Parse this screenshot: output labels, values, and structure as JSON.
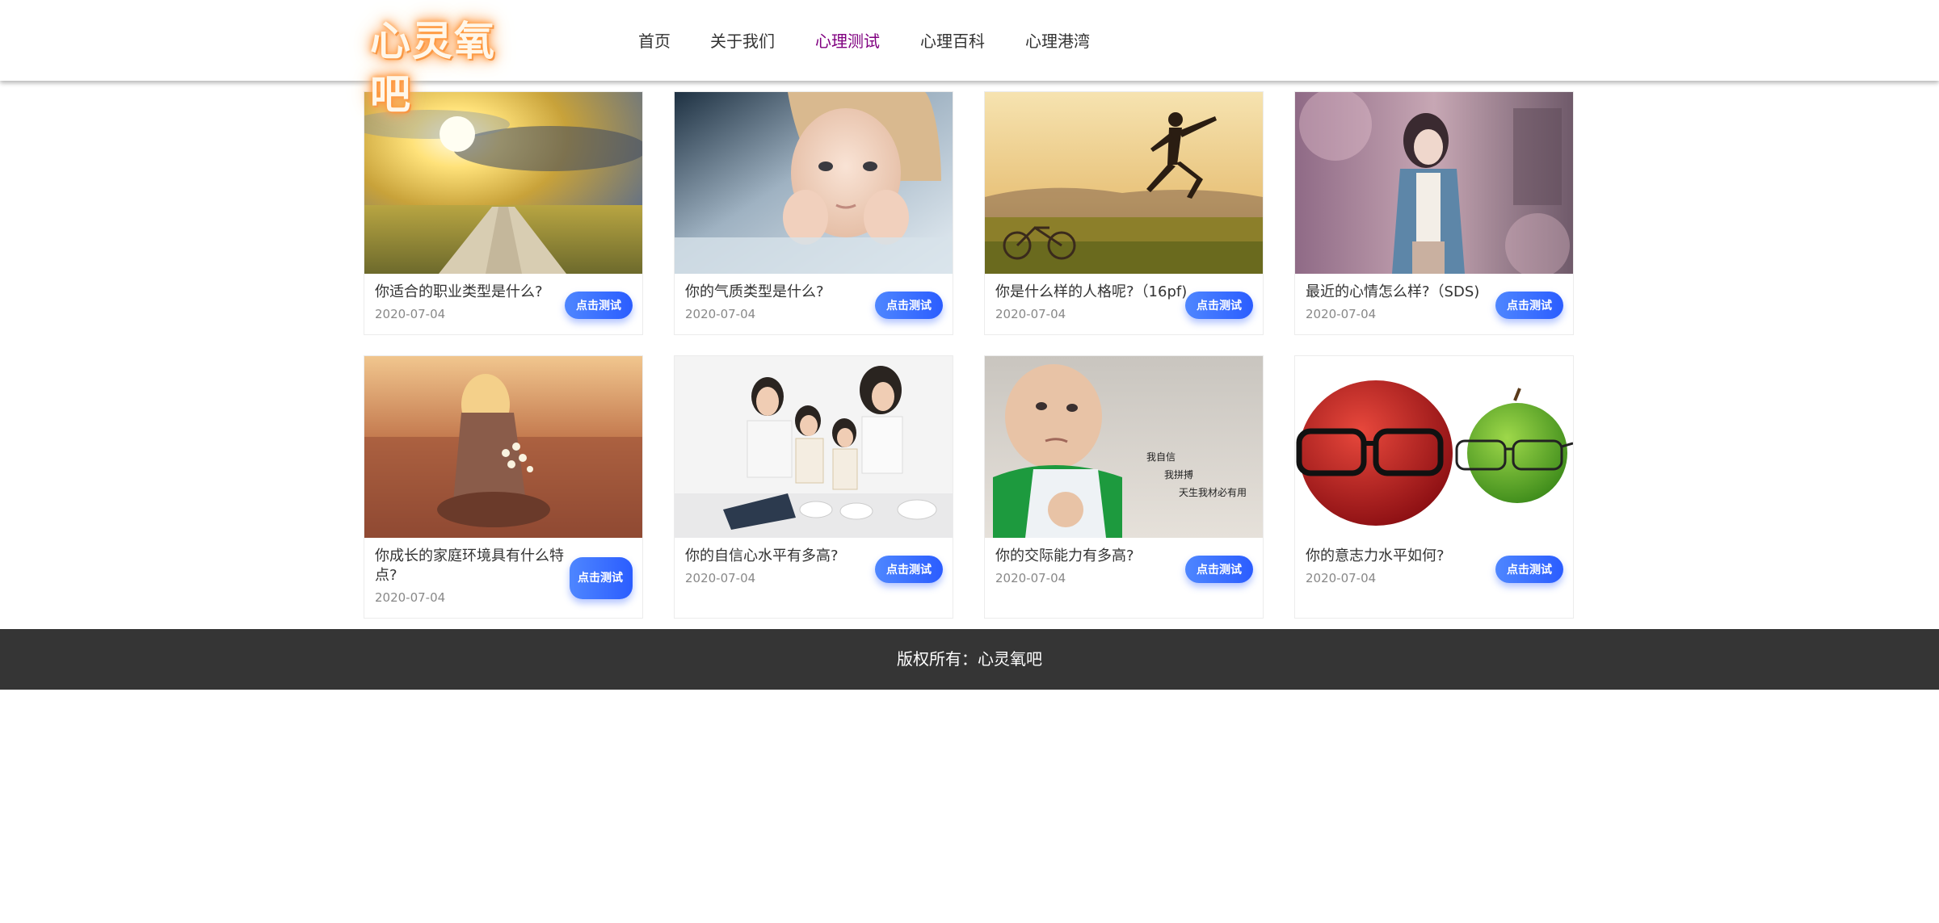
{
  "brand": {
    "logo_text": "心灵氧吧"
  },
  "nav": {
    "items": [
      {
        "label": "首页"
      },
      {
        "label": "关于我们"
      },
      {
        "label": "心理测试",
        "active": true
      },
      {
        "label": "心理百科"
      },
      {
        "label": "心理港湾"
      }
    ],
    "active_color": "#800080"
  },
  "cards": [
    {
      "title": "你适合的职业类型是什么?",
      "date": "2020-07-04",
      "button": "点击测试",
      "image": "sunlit-road-field"
    },
    {
      "title": "你的气质类型是什么?",
      "date": "2020-07-04",
      "button": "点击测试",
      "image": "child-portrait"
    },
    {
      "title": "你是什么样的人格呢?（16pf)",
      "date": "2020-07-04",
      "button": "点击测试",
      "image": "jumping-person-sunset"
    },
    {
      "title": "最近的心情怎么样?（SDS)",
      "date": "2020-07-04",
      "button": "点击测试",
      "image": "woman-in-jacket"
    },
    {
      "title": "你成长的家庭环境具有什么特点?",
      "date": "2020-07-04",
      "button": "点击测试",
      "image": "girl-with-flowers"
    },
    {
      "title": "你的自信心水平有多高?",
      "date": "2020-07-04",
      "button": "点击测试",
      "image": "family-sitting"
    },
    {
      "title": "你的交际能力有多高?",
      "date": "2020-07-04",
      "button": "点击测试",
      "image": "baby-fist-meme"
    },
    {
      "title": "你的意志力水平如何?",
      "date": "2020-07-04",
      "button": "点击测试",
      "image": "apples-with-glasses"
    }
  ],
  "meme_text": [
    "我自信",
    "我拼搏",
    "天生我材必有用"
  ],
  "footer": {
    "copyright": "版权所有：心灵氧吧"
  },
  "colors": {
    "button_gradient_start": "#4e86ff",
    "button_gradient_end": "#2b5dff",
    "footer_bg": "#353535"
  }
}
